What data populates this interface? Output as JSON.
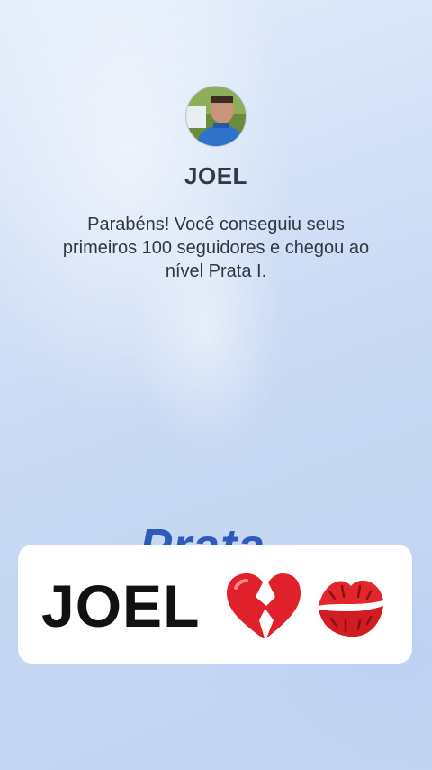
{
  "profile": {
    "username": "JOEL"
  },
  "congrats": {
    "message": "Parabéns! Você conseguiu seus primeiros 100 seguidores e chegou ao nível Prata I."
  },
  "level_badge": {
    "word": "Prata",
    "color": "#2e5bb8"
  },
  "caption": {
    "text": "JOEL",
    "emojis": [
      "broken-heart-icon",
      "kiss-mark-icon"
    ]
  },
  "colors": {
    "background_top": "#e4eefb",
    "background_bottom": "#c1d4f1",
    "heart_red": "#e0202a"
  }
}
